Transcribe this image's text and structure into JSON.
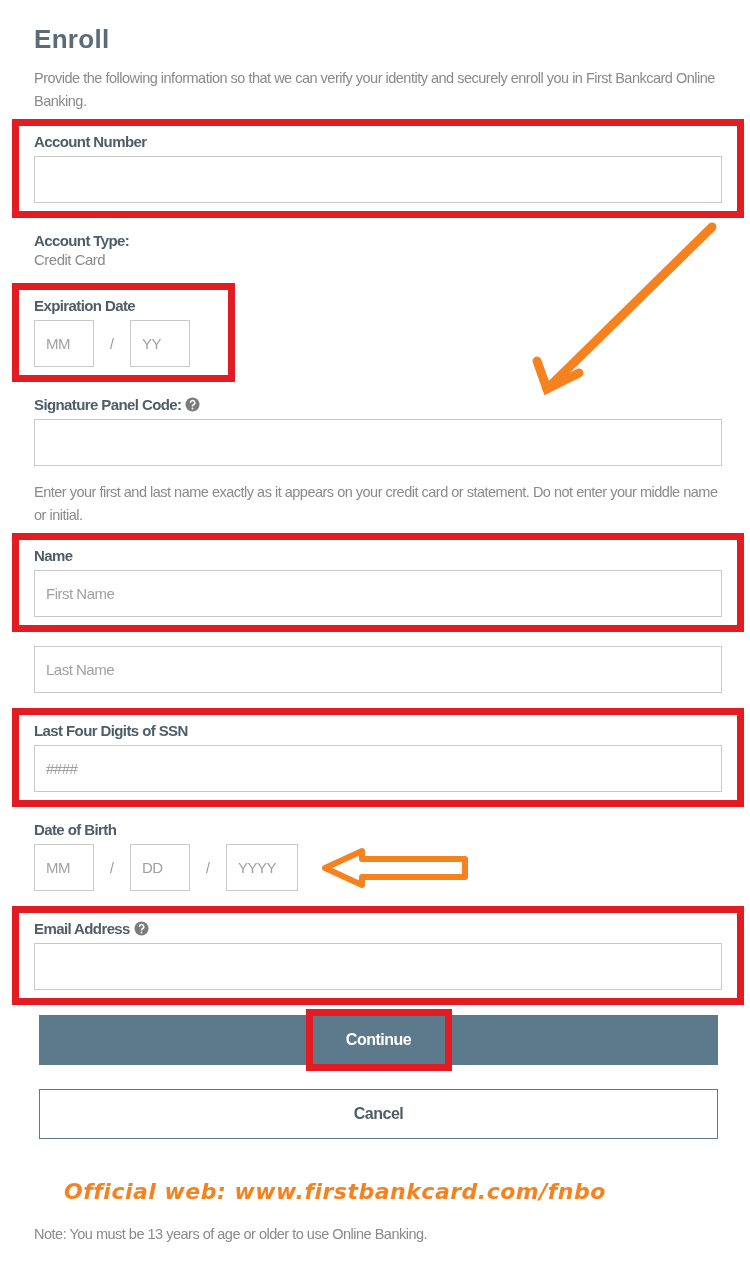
{
  "title": "Enroll",
  "intro": "Provide the following information so that we can verify your identity and securely enroll you in First Bankcard Online Banking.",
  "fields": [
    {
      "kind": "text",
      "label": "Account Number",
      "highlighted": true
    },
    {
      "kind": "static",
      "label": "Account Type:",
      "value": "Credit Card",
      "highlighted": false
    },
    {
      "kind": "date",
      "label": "Expiration Date",
      "highlighted": true,
      "parts": [
        {
          "kind": "input",
          "placeholder": "MM"
        },
        {
          "kind": "separator",
          "text": "/"
        },
        {
          "kind": "input",
          "placeholder": "YY"
        }
      ]
    },
    {
      "kind": "text",
      "label": "Signature Panel Code:",
      "help": true,
      "pointer": {
        "kind": "diagonal"
      },
      "highlighted": false
    },
    {
      "kind": "note",
      "text": "Enter your first and last name exactly as it appears on your credit card or statement. Do not enter your middle name or initial."
    },
    {
      "kind": "text",
      "label": "Name",
      "placeholder": "First Name",
      "highlighted": true
    },
    {
      "kind": "text",
      "placeholder": "Last Name",
      "highlighted": false
    },
    {
      "kind": "text",
      "label": "Last Four Digits of SSN",
      "placeholder": "####",
      "highlighted": true
    },
    {
      "kind": "date",
      "label": "Date of Birth",
      "pointer": {
        "kind": "left"
      },
      "highlighted": false,
      "parts": [
        {
          "kind": "input",
          "placeholder": "MM"
        },
        {
          "kind": "separator",
          "text": "/"
        },
        {
          "kind": "input",
          "placeholder": "DD"
        },
        {
          "kind": "separator",
          "text": "/"
        },
        {
          "kind": "input",
          "placeholder": "YYYY"
        }
      ]
    },
    {
      "kind": "text",
      "label": "Email Address",
      "help": true,
      "highlighted": true
    }
  ],
  "buttons": [
    {
      "kind": "primary",
      "label": "Continue",
      "highlighted": true
    },
    {
      "kind": "secondary",
      "label": "Cancel",
      "highlighted": false
    }
  ],
  "annotation": "Official web: www.firstbankcard.com/fnbo",
  "note": "Note: You must be 13 years of age or older to use Online Banking."
}
